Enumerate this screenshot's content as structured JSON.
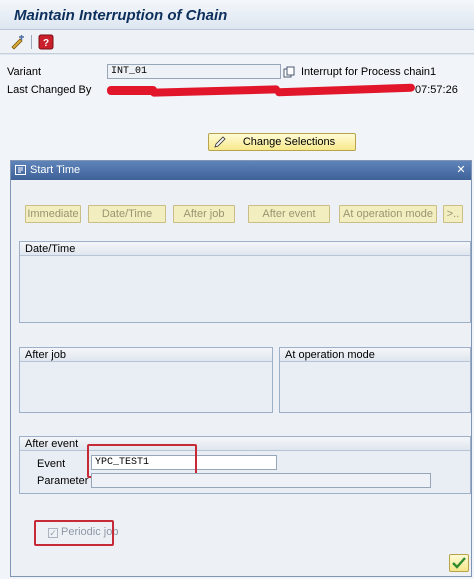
{
  "window": {
    "title": "Maintain Interruption of Chain"
  },
  "toolbar": {
    "icons": [
      "display-change-icon",
      "help-icon"
    ]
  },
  "form": {
    "variant_label": "Variant",
    "variant_value": "INT_01",
    "variant_description": "Interrupt for Process chain1",
    "last_changed_label": "Last Changed By",
    "time_value": "07:57:26",
    "change_selections_label": "Change Selections"
  },
  "dialog": {
    "title": "Start Time",
    "buttons": {
      "immediate": "Immediate",
      "date_time": "Date/Time",
      "after_job": "After job",
      "after_event": "After event",
      "at_operation_mode": "At operation mode",
      "more": ">.."
    },
    "groups": {
      "date_time": "Date/Time",
      "after_job": "After job",
      "at_operation_mode": "At operation mode",
      "after_event": "After event"
    },
    "event_label": "Event",
    "event_value": "YPC_TEST1",
    "parameter_label": "Parameter",
    "parameter_value": "",
    "periodic_job_label": "Periodic job",
    "periodic_job_checked": true
  },
  "colors": {
    "redaction": "#e2162b",
    "highlight": "#c52a36",
    "dialog_header": "#4a6ea5"
  }
}
